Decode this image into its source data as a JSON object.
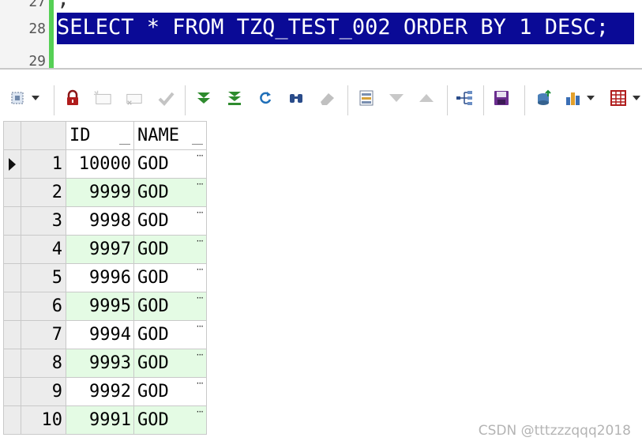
{
  "editor": {
    "lines": [
      {
        "number": "27",
        "text": ";"
      },
      {
        "number": "28",
        "text": "SELECT * FROM TZQ_TEST_002 ORDER BY 1 DESC;"
      },
      {
        "number": "29",
        "text": ""
      }
    ]
  },
  "toolbar": {
    "icons": [
      "select-mode-icon",
      "dropdown-arrow-icon",
      "lock-icon",
      "insert-record-icon",
      "delete-record-icon",
      "post-changes-icon",
      "fetch-next-icon",
      "fetch-last-icon",
      "refresh-icon",
      "find-icon",
      "clear-icon",
      "single-record-view-icon",
      "filter-down-icon",
      "filter-up-icon",
      "query-by-example-icon",
      "save-icon",
      "export-icon",
      "chart-icon",
      "dropdown-arrow-icon",
      "grid-options-icon",
      "dropdown-arrow-icon"
    ]
  },
  "grid": {
    "columns": [
      "ID",
      "NAME"
    ],
    "rows": [
      {
        "no": "1",
        "id": "10000",
        "name": "GOD"
      },
      {
        "no": "2",
        "id": "9999",
        "name": "GOD"
      },
      {
        "no": "3",
        "id": "9998",
        "name": "GOD"
      },
      {
        "no": "4",
        "id": "9997",
        "name": "GOD"
      },
      {
        "no": "5",
        "id": "9996",
        "name": "GOD"
      },
      {
        "no": "6",
        "id": "9995",
        "name": "GOD"
      },
      {
        "no": "7",
        "id": "9994",
        "name": "GOD"
      },
      {
        "no": "8",
        "id": "9993",
        "name": "GOD"
      },
      {
        "no": "9",
        "id": "9992",
        "name": "GOD"
      },
      {
        "no": "10",
        "id": "9991",
        "name": "GOD"
      }
    ],
    "cell_button_label": "···",
    "current_row": "1"
  },
  "watermark": "CSDN @tttzzzqqq2018",
  "colors": {
    "selection": "#0a0a96",
    "gutter_marker": "#55d055",
    "alt_row": "#e4fbe4"
  }
}
